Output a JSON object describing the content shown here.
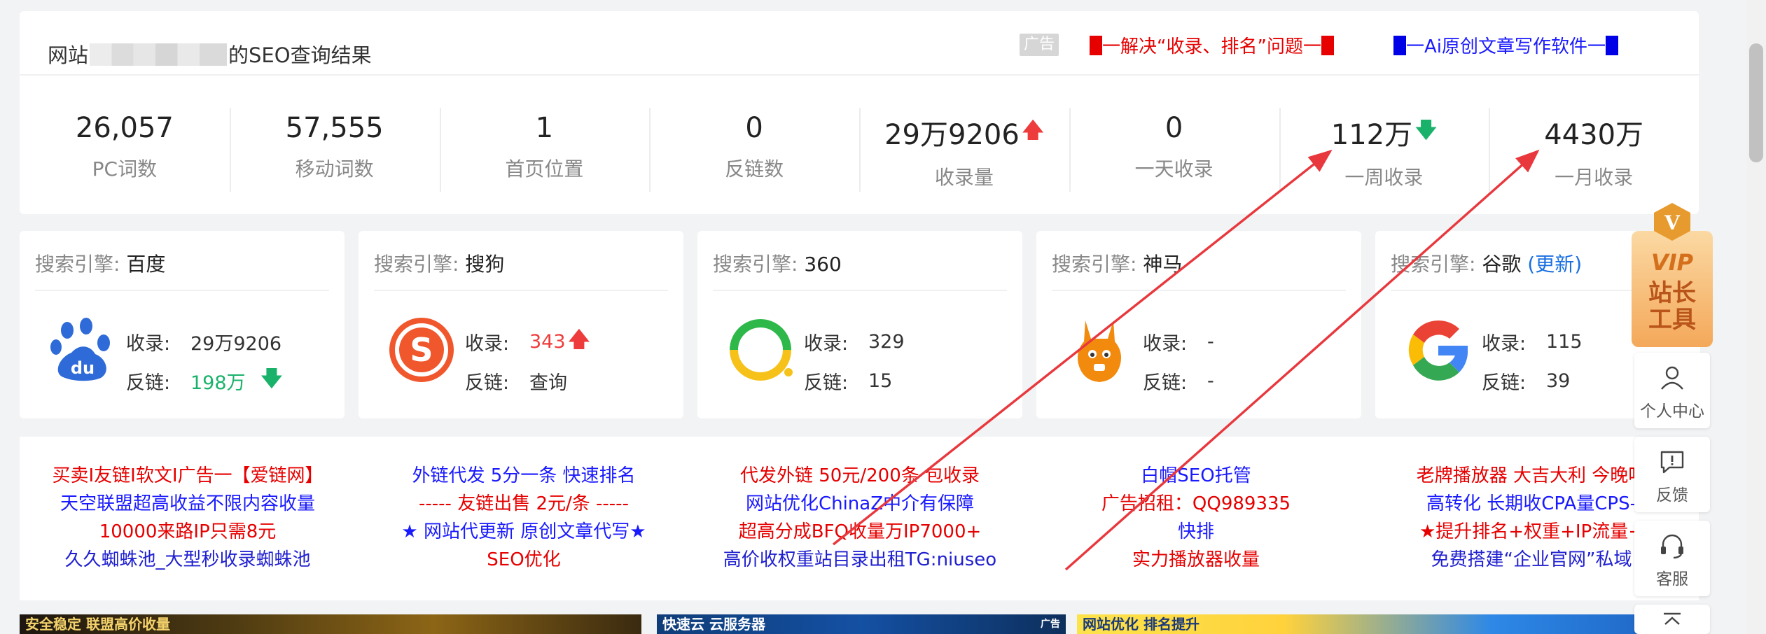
{
  "header": {
    "title_prefix": "网站",
    "title_suffix": "的SEO查询结果",
    "ad_badge": "广告",
    "ad_link_1": "一解决“收录、排名”问题一",
    "ad_link_2": "一Ai原创文章写作软件一"
  },
  "stats": [
    {
      "value": "26,057",
      "label": "PC词数",
      "trend": ""
    },
    {
      "value": "57,555",
      "label": "移动词数",
      "trend": ""
    },
    {
      "value": "1",
      "label": "首页位置",
      "trend": ""
    },
    {
      "value": "0",
      "label": "反链数",
      "trend": ""
    },
    {
      "value": "29万9206",
      "label": "收录量",
      "trend": "up"
    },
    {
      "value": "0",
      "label": "一天收录",
      "trend": ""
    },
    {
      "value": "112万",
      "label": "一周收录",
      "trend": "down"
    },
    {
      "value": "4430万",
      "label": "一月收录",
      "trend": ""
    }
  ],
  "engines": {
    "prefix": "搜索引擎:",
    "index_label": "收录:",
    "backlink_label": "反链:",
    "items": [
      {
        "name": "百度",
        "index": "29万9206",
        "backlink": "198万",
        "index_trend": "",
        "backlink_trend": "down"
      },
      {
        "name": "搜狗",
        "index": "343",
        "backlink": "查询",
        "index_trend": "up",
        "backlink_trend": ""
      },
      {
        "name": "360",
        "index": "329",
        "backlink": "15",
        "index_trend": "",
        "backlink_trend": ""
      },
      {
        "name": "神马",
        "index": "-",
        "backlink": "-",
        "index_trend": "",
        "backlink_trend": ""
      },
      {
        "name": "谷歌",
        "update": "(更新)",
        "index": "115",
        "backlink": "39",
        "index_trend": "",
        "backlink_trend": ""
      }
    ]
  },
  "text_ads": [
    [
      "买卖I友链I软文I广告一【爱链网】",
      "天空联盟超高收益不限内容收量",
      "10000来路IP只需8元",
      "久久蜘蛛池_大型秒收录蜘蛛池"
    ],
    [
      "外链代发 5分一条 快速排名",
      "----- 友链出售 2元/条 -----",
      "★ 网站代更新 原创文章代写★",
      "SEO优化"
    ],
    [
      "代发外链 50元/200条 包收录",
      "网站优化ChinaZ中介有保障",
      "超高分成BFQ收量万IP7000+",
      "高价收权重站目录出租TG:niuseo"
    ],
    [
      "白帽SEO托管",
      "广告招租：QQ989335",
      "快排",
      "实力播放器收量"
    ],
    [
      "老牌播放器 大吉大利 今晚吃",
      "高转化 长期收CPA量CPS-",
      "★提升排名+权重+IP流量+",
      "免费搭建“企业官网”私域"
    ]
  ],
  "banners": {
    "b1": "安全稳定   联盟高价收量",
    "b2": "快速云   云服务器",
    "b2_badge": "广告",
    "b3": "网站优化 排名提升"
  },
  "side_tools": {
    "vip_line1": "VIP",
    "vip_line2": "站长",
    "vip_line3": "工具",
    "vip_letter": "V",
    "personal": "个人中心",
    "feedback": "反馈",
    "service": "客服"
  },
  "colors": {
    "up": "#ee3b3b",
    "down": "#1ab26b",
    "ad_red": "#e60000",
    "ad_blue": "#1a1aff",
    "link": "#1a6fe0"
  }
}
